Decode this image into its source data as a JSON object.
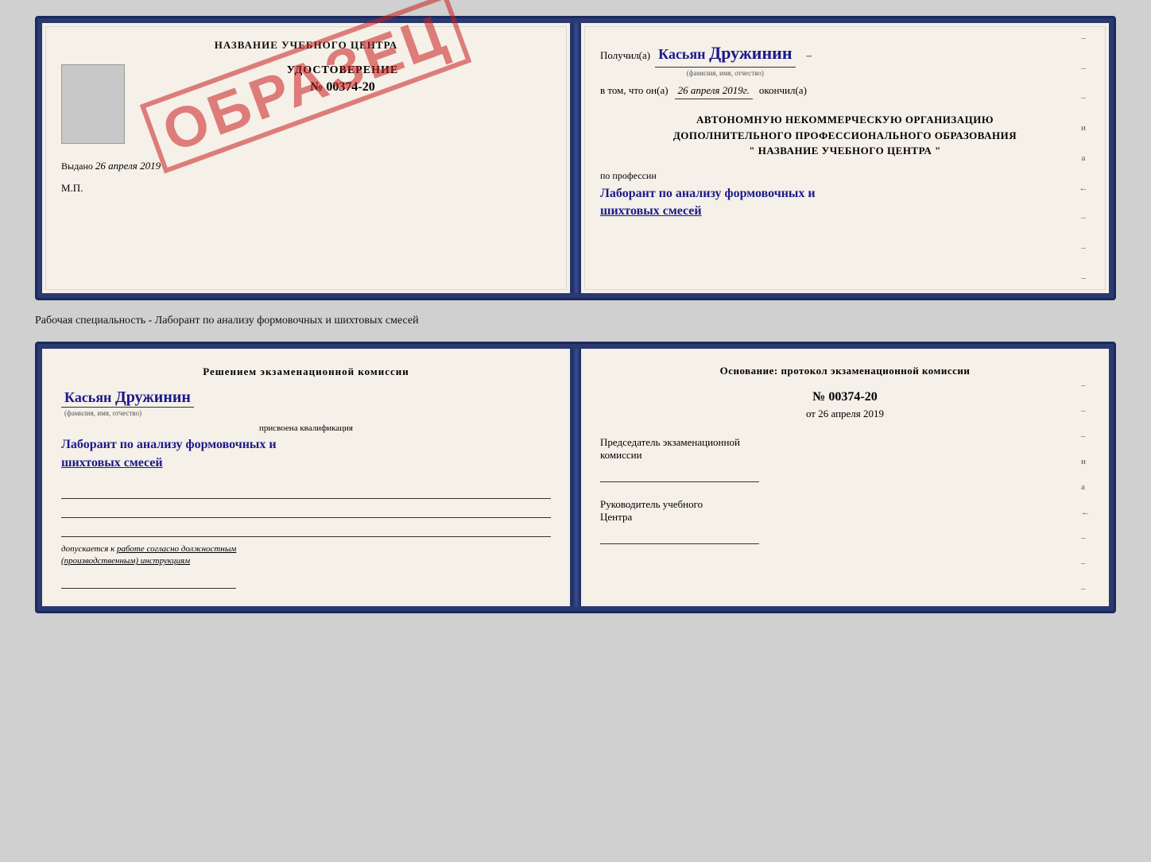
{
  "document": {
    "top_book": {
      "left_page": {
        "title": "НАЗВАНИЕ УЧЕБНОГО ЦЕНТРА",
        "stamp": "ОБРАЗЕЦ",
        "cert_label": "УДОСТОВЕРЕНИЕ",
        "cert_number": "№ 00374-20",
        "issued_label": "Выдано",
        "issued_date": "26 апреля 2019",
        "mp_label": "М.П."
      },
      "right_page": {
        "received_label": "Получил(а)",
        "received_name": "Касьян Дружинин",
        "name_sublabel": "(фамилия, имя, отчество)",
        "date_prefix": "в том, что он(а)",
        "date_value": "26 апреля 2019г.",
        "date_suffix": "окончил(а)",
        "org_line1": "АВТОНОМНУЮ НЕКОММЕРЧЕСКУЮ ОРГАНИЗАЦИЮ",
        "org_line2": "ДОПОЛНИТЕЛЬНОГО ПРОФЕССИОНАЛЬНОГО ОБРАЗОВАНИЯ",
        "org_line3": "\"   НАЗВАНИЕ УЧЕБНОГО ЦЕНТРА   \"",
        "profession_label": "по профессии",
        "profession_name": "Лаборант по анализу формовочных и\nшихтовых смесей",
        "right_letters": [
          "и",
          "а",
          "←",
          "–",
          "–",
          "–"
        ]
      }
    },
    "middle_text": "Рабочая специальность - Лаборант по анализу формовочных и шихтовых смесей",
    "bottom_book": {
      "left_page": {
        "decision_title": "Решением  экзаменационной  комиссии",
        "person_name": "Касьян Дружинин",
        "person_sublabel": "(фамилия, имя, отчество)",
        "qualification_label": "присвоена квалификация",
        "qualification_text": "Лаборант по анализу формовочных и\nшихтовых смесей",
        "допускается_text": "допускается к  работе согласно должностным\n(производственным) инструкциям"
      },
      "right_page": {
        "basis_title": "Основание: протокол экзаменационной  комиссии",
        "protocol_number": "№  00374-20",
        "protocol_date_prefix": "от",
        "protocol_date": "26 апреля 2019",
        "chairman_title": "Председатель экзаменационной\nкомиссии",
        "director_title": "Руководитель учебного\nЦентра",
        "right_letters": [
          "–",
          "–",
          "–",
          "и",
          "а",
          "←",
          "–",
          "–",
          "–"
        ]
      }
    }
  }
}
